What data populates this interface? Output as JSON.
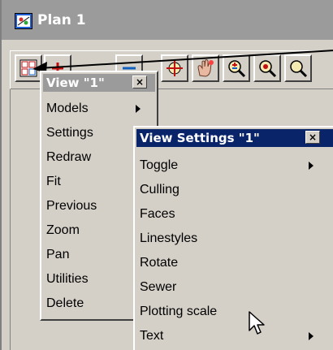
{
  "window": {
    "title": "Plan 1"
  },
  "toolbar": {
    "tools": [
      {
        "icon": "view-menu-icon"
      },
      {
        "icon": "zoom-in-icon"
      },
      {
        "icon": "zoom-out-icon"
      },
      {
        "icon": "fit-icon"
      },
      {
        "icon": "pan-hand-icon"
      },
      {
        "icon": "zoom-plus-minus-icon"
      },
      {
        "icon": "zoom-previous-icon"
      },
      {
        "icon": "zoom-extra-icon"
      }
    ]
  },
  "view_menu": {
    "title": "View \"1\"",
    "close_label": "×",
    "items": [
      {
        "label": "Models",
        "submenu": true
      },
      {
        "label": "Settings",
        "submenu": false
      },
      {
        "label": "Redraw",
        "submenu": false
      },
      {
        "label": "Fit",
        "submenu": false
      },
      {
        "label": "Previous",
        "submenu": false
      },
      {
        "label": "Zoom",
        "submenu": false
      },
      {
        "label": "Pan",
        "submenu": false
      },
      {
        "label": "Utilities",
        "submenu": false
      },
      {
        "label": "Delete",
        "submenu": false
      }
    ]
  },
  "view_settings_menu": {
    "title": "View Settings \"1\"",
    "close_label": "×",
    "items": [
      {
        "label": "Toggle",
        "submenu": true
      },
      {
        "label": "Culling",
        "submenu": false
      },
      {
        "label": "Faces",
        "submenu": false
      },
      {
        "label": "Linestyles",
        "submenu": false
      },
      {
        "label": "Rotate",
        "submenu": false
      },
      {
        "label": "Sewer",
        "submenu": false
      },
      {
        "label": "Plotting scale",
        "submenu": false
      },
      {
        "label": "Text",
        "submenu": true
      }
    ]
  },
  "colors": {
    "face": "#d4d0c8",
    "titlebar_inactive": "#9b9b9b",
    "popup_title_inactive": "#9b9b9b",
    "popup_title_active": "#0a246a"
  }
}
